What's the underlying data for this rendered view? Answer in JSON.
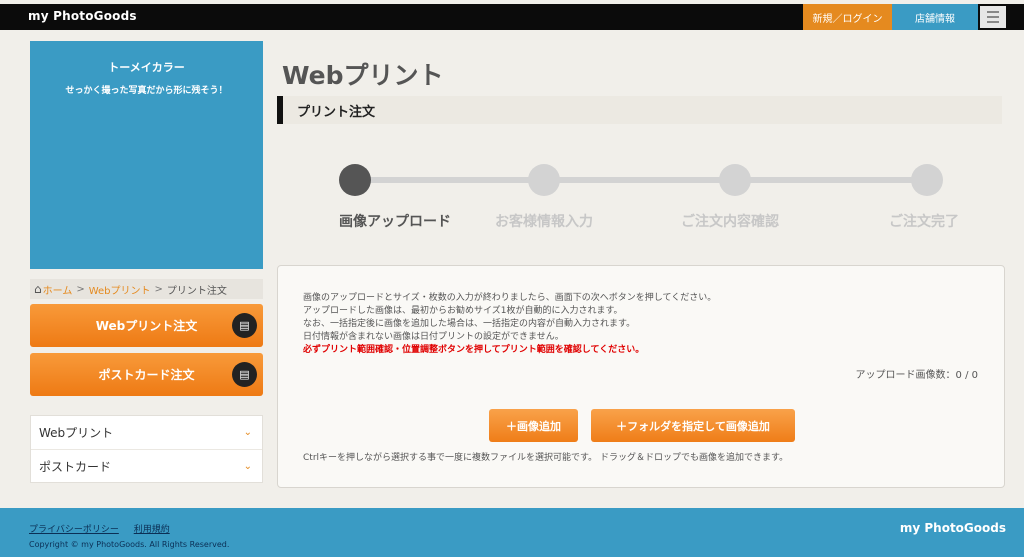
{
  "header": {
    "logo": "my PhotoGoods",
    "login_label": "新規／ログイン",
    "store_label": "店舗情報",
    "menu_icon": "hamburger-icon"
  },
  "sidebar": {
    "banner_title": "トーメイカラー",
    "banner_subtitle": "せっかく撮った写真だから形に残そう！",
    "breadcrumb": {
      "home": "ホーム",
      "webprint": "Webプリント",
      "current": "プリント注文",
      "separator": ">"
    },
    "buttons": [
      {
        "label": "Webプリント注文",
        "icon": "pc-smartphone-icon"
      },
      {
        "label": "ポストカード注文",
        "icon": "pc-smartphone-icon"
      }
    ],
    "menu": [
      {
        "label": "Webプリント"
      },
      {
        "label": "ポストカード"
      }
    ]
  },
  "main": {
    "title": "Webプリント",
    "section": "プリント注文",
    "steps": [
      {
        "label": "画像アップロード",
        "active": true
      },
      {
        "label": "お客様情報入力",
        "active": false
      },
      {
        "label": "ご注文内容確認",
        "active": false
      },
      {
        "label": "ご注文完了",
        "active": false
      }
    ],
    "instructions": [
      "画像のアップロードとサイズ・枚数の入力が終わりましたら、画面下の次へボタンを押してください。",
      "アップロードした画像は、最初からお勧めサイズ1枚が自動的に入力されます。",
      "なお、一括指定後に画像を追加した場合は、一括指定の内容が自動入力されます。",
      "日付情報が含まれない画像は日付プリントの設定ができません。"
    ],
    "warning": "必ずプリント範囲確認・位置調整ボタンを押してプリント範囲を確認してください。",
    "upload_count": "アップロード画像数：0 / 0",
    "add_image_label": "＋画像追加",
    "add_folder_label": "＋フォルダを指定して画像追加",
    "hint": "Ctrlキーを押しながら選択する事で一度に複数ファイルを選択可能です。 ドラッグ＆ドロップでも画像を追加できます。"
  },
  "footer": {
    "privacy": "プライバシーポリシー",
    "terms": "利用規約",
    "copyright": "Copyright © my PhotoGoods. All Rights Reserved.",
    "logo": "my PhotoGoods"
  },
  "colors": {
    "accent_orange": "#ee7a14",
    "accent_blue": "#3a9bc4",
    "warning_red": "#e00000"
  }
}
